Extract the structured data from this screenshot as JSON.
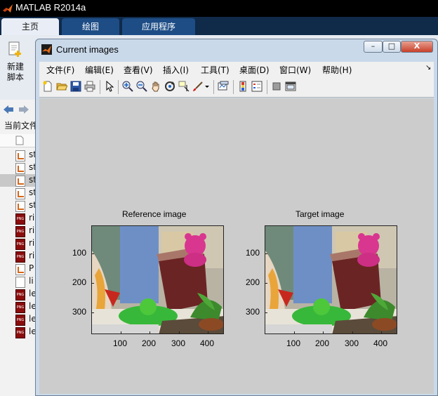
{
  "main_window": {
    "title": "MATLAB R2014a",
    "tabs": [
      {
        "label": "主页",
        "active": true
      },
      {
        "label": "绘图",
        "active": false
      },
      {
        "label": "应用程序",
        "active": false
      }
    ],
    "new_script": {
      "line1": "新建",
      "line2": "脚本"
    },
    "current_folder_label": "当前文件",
    "files": [
      {
        "name": "st",
        "type": "m"
      },
      {
        "name": "st",
        "type": "m"
      },
      {
        "name": "st",
        "type": "m",
        "selected": true
      },
      {
        "name": "st",
        "type": "m"
      },
      {
        "name": "st",
        "type": "m"
      },
      {
        "name": "ri",
        "type": "png"
      },
      {
        "name": "ri",
        "type": "png"
      },
      {
        "name": "ri",
        "type": "png"
      },
      {
        "name": "ri",
        "type": "png"
      },
      {
        "name": "P",
        "type": "m"
      },
      {
        "name": "li",
        "type": "doc"
      },
      {
        "name": "le",
        "type": "png"
      },
      {
        "name": "le",
        "type": "png"
      },
      {
        "name": "le",
        "type": "png"
      },
      {
        "name": "le",
        "type": "png"
      }
    ]
  },
  "figure": {
    "title": "Current images",
    "window_buttons": {
      "minimize": "–",
      "maximize": "□",
      "close": "X"
    },
    "menu": [
      "文件(F)",
      "编辑(E)",
      "查看(V)",
      "插入(I)",
      "工具(T)",
      "桌面(D)",
      "窗口(W)",
      "帮助(H)"
    ],
    "menu_overflow": "↘",
    "toolbar": [
      "new-figure-icon",
      "open-icon",
      "save-icon",
      "print-icon",
      "pointer-icon",
      "zoom-in-icon",
      "zoom-out-icon",
      "pan-icon",
      "rotate-icon",
      "data-cursor-icon",
      "brush-icon",
      "link-plot-icon",
      "colorbar-icon",
      "legend-icon",
      "hide-plot-tools-icon",
      "show-plot-tools-icon"
    ],
    "axes": [
      {
        "title": "Reference image",
        "xticks": [
          "100",
          "200",
          "300",
          "400"
        ],
        "yticks": [
          "100",
          "200",
          "300"
        ]
      },
      {
        "title": "Target image",
        "xticks": [
          "100",
          "200",
          "300",
          "400"
        ],
        "yticks": [
          "100",
          "200",
          "300"
        ]
      }
    ]
  },
  "colors": {
    "titlebar": "#000000",
    "ribbon_tab": "#1e4d86",
    "figure_frame": "#c9d9ea",
    "canvas": "#cccccc"
  }
}
